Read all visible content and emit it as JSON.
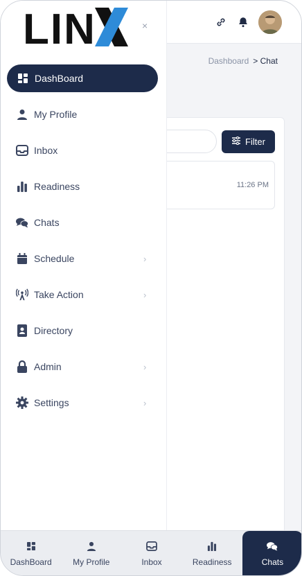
{
  "brand": {
    "logo_text": "LINX",
    "close_symbol": "×"
  },
  "breadcrumb": {
    "parent": "Dashboard",
    "current": "> Chat"
  },
  "toolbar": {
    "filter_label": "Filter"
  },
  "chat_list": [
    {
      "time": "11:26 PM"
    }
  ],
  "sidebar": {
    "items": [
      {
        "label": "DashBoard",
        "icon": "dashboard-icon",
        "chevron": false
      },
      {
        "label": "My Profile",
        "icon": "user-icon",
        "chevron": false
      },
      {
        "label": "Inbox",
        "icon": "inbox-icon",
        "chevron": false
      },
      {
        "label": "Readiness",
        "icon": "bar-chart-icon",
        "chevron": false
      },
      {
        "label": "Chats",
        "icon": "chat-bubbles-icon",
        "chevron": false
      },
      {
        "label": "Schedule",
        "icon": "calendar-icon",
        "chevron": true
      },
      {
        "label": "Take Action",
        "icon": "broadcast-tower-icon",
        "chevron": true
      },
      {
        "label": "Directory",
        "icon": "address-book-icon",
        "chevron": false
      },
      {
        "label": "Admin",
        "icon": "lock-icon",
        "chevron": true
      },
      {
        "label": "Settings",
        "icon": "gear-icon",
        "chevron": true
      }
    ]
  },
  "bottom_nav": {
    "items": [
      {
        "label": "DashBoard",
        "icon": "dashboard-icon"
      },
      {
        "label": "My Profile",
        "icon": "user-icon"
      },
      {
        "label": "Inbox",
        "icon": "inbox-icon"
      },
      {
        "label": "Readiness",
        "icon": "bar-chart-icon"
      },
      {
        "label": "Chats",
        "icon": "chat-bubbles-icon",
        "active": true
      }
    ]
  },
  "colors": {
    "primary": "#1d2b4a",
    "logo_blue": "#2e8bd8",
    "text": "#3a4560"
  }
}
